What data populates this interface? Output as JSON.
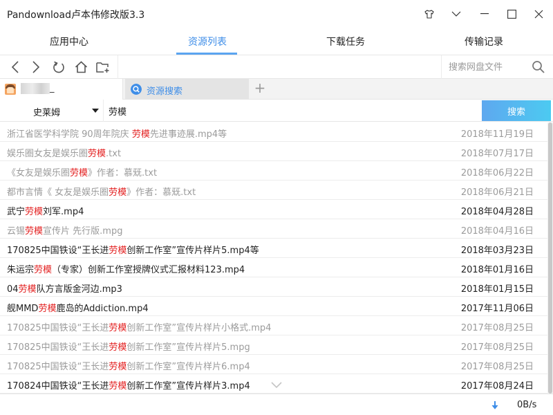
{
  "window": {
    "title": "Pandownload卢本伟修改版3.3"
  },
  "main_tabs": [
    {
      "label": "应用中心"
    },
    {
      "label": "资源列表"
    },
    {
      "label": "下载任务"
    },
    {
      "label": "传输记录"
    }
  ],
  "active_tab": "资源列表",
  "toolbar": {
    "search_placeholder": "搜索网盘文件"
  },
  "account": {
    "name_suffix": "_"
  },
  "search_tab": {
    "label": "资源搜索"
  },
  "search": {
    "source": "史莱姆",
    "query": "劳模",
    "button_label": "搜索"
  },
  "results": [
    {
      "pre": "浙江省医学科学院 90周年院庆 ",
      "hl": "劳模",
      "post": "先进事迹展.mp4等",
      "date": "2018年11月19日",
      "dim": true
    },
    {
      "pre": "娱乐圈女友是娱乐圈",
      "hl": "劳模",
      "post": ".txt",
      "date": "2018年07月17日",
      "dim": true
    },
    {
      "pre": "《女友是娱乐圈",
      "hl": "劳模",
      "post": "》作者：慕兓.txt",
      "date": "2018年06月22日",
      "dim": true
    },
    {
      "pre": "都市言情《 女友是娱乐圈",
      "hl": "劳模",
      "post": "》作者：慕兓.txt",
      "date": "2018年06月21日",
      "dim": true
    },
    {
      "pre": "武宁",
      "hl": "劳模",
      "post": "刘军.mp4",
      "date": "2018年04月28日",
      "dim": false
    },
    {
      "pre": "云锡",
      "hl": "劳模",
      "post": "宣传片 先行版.mpg",
      "date": "2018年04月16日",
      "dim": true
    },
    {
      "pre": "170825中国铁设“王长进",
      "hl": "劳模",
      "post": "创新工作室”宣传片样片5.mp4等",
      "date": "2018年03月23日",
      "dim": false
    },
    {
      "pre": "朱运宗",
      "hl": "劳模",
      "post": "（专家）创新工作室授牌仪式汇报材料123.mp4",
      "date": "2018年01月16日",
      "dim": false
    },
    {
      "pre": "04",
      "hl": "劳模",
      "post": "队方言版金河边.mp3",
      "date": "2018年01月15日",
      "dim": false
    },
    {
      "pre": "舰MMD",
      "hl": "劳模",
      "post": "鹿岛的Addiction.mp4",
      "date": "2017年11月06日",
      "dim": false
    },
    {
      "pre": "170825中国铁设“王长进",
      "hl": "劳模",
      "post": "创新工作室”宣传片样片小格式.mp4",
      "date": "2017年08月25日",
      "dim": true
    },
    {
      "pre": "170825中国铁设“王长进",
      "hl": "劳模",
      "post": "创新工作室”宣传片样片5.mpg",
      "date": "2017年08月25日",
      "dim": true
    },
    {
      "pre": "170825中国铁设“王长进",
      "hl": "劳模",
      "post": "创新工作室”宣传片样片6.mp4",
      "date": "2017年08月25日",
      "dim": true
    },
    {
      "pre": "170824中国铁设“王长进",
      "hl": "劳模",
      "post": "创新工作室”宣传片样片3.mp4",
      "date": "2017年08月24日",
      "dim": false
    }
  ],
  "status": {
    "speed": "0B/s"
  },
  "colors": {
    "accent": "#3f8ee8",
    "highlight": "#e32020",
    "search_button_start": "#5ea8ef",
    "search_button_end": "#4ccaf1",
    "dim_text": "#9b9b9b"
  },
  "icons": [
    "shirt-icon",
    "minimize-down-icon",
    "maximize-icon",
    "close-icon",
    "back-icon",
    "forward-icon",
    "refresh-icon",
    "home-icon",
    "new-folder-icon",
    "search-icon",
    "add-tab-icon",
    "download-arrow-icon",
    "scroll-more-icon"
  ]
}
